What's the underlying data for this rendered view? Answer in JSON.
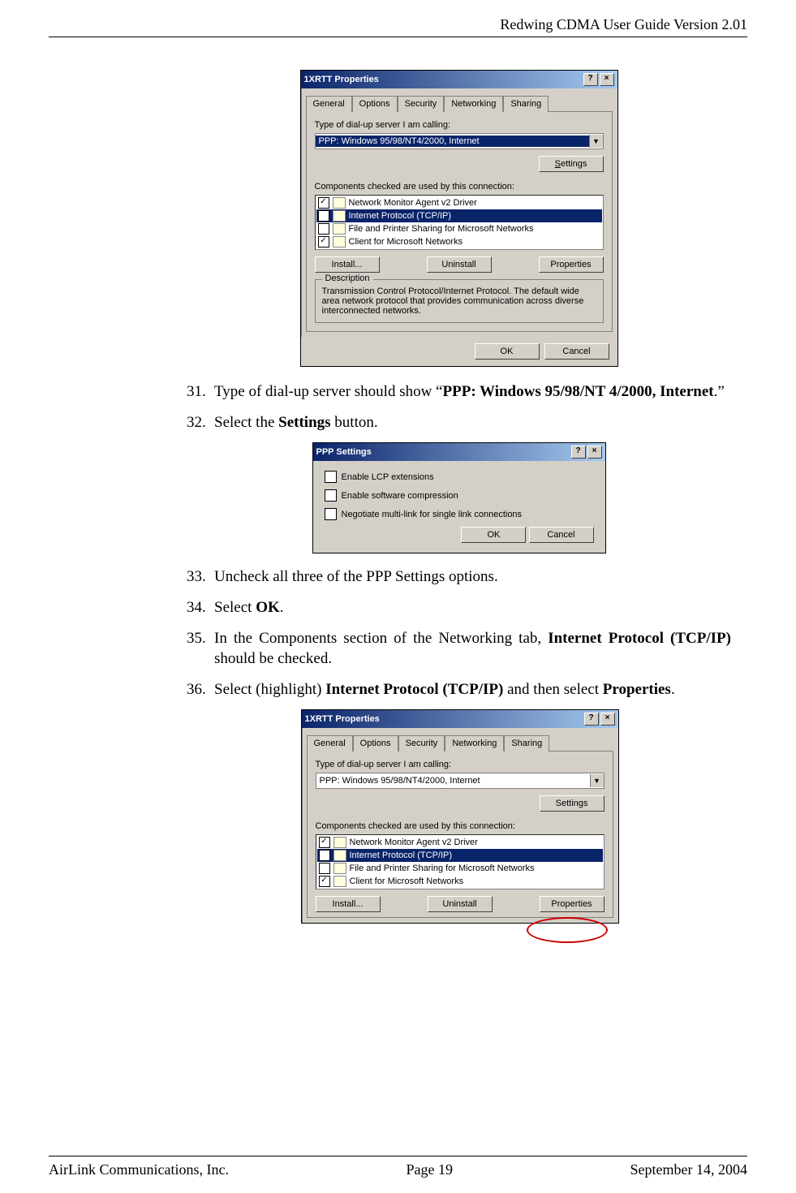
{
  "header": {
    "doc_title": "Redwing CDMA User Guide Version 2.01"
  },
  "footer": {
    "company": "AirLink Communications, Inc.",
    "page": "Page 19",
    "date": "September 14, 2004"
  },
  "dialog1": {
    "title": "1XRTT Properties",
    "tabs": [
      "General",
      "Options",
      "Security",
      "Networking",
      "Sharing"
    ],
    "active_tab": "Networking",
    "type_label": "Type of dial-up server I am calling:",
    "dropdown_value": "PPP: Windows 95/98/NT4/2000, Internet",
    "settings_btn": "Settings",
    "components_label": "Components checked are used by this connection:",
    "components": [
      {
        "checked": true,
        "label": "Network Monitor Agent v2 Driver",
        "selected": false
      },
      {
        "checked": true,
        "label": "Internet Protocol (TCP/IP)",
        "selected": true
      },
      {
        "checked": false,
        "label": "File and Printer Sharing for Microsoft Networks",
        "selected": false
      },
      {
        "checked": true,
        "label": "Client for Microsoft Networks",
        "selected": false
      }
    ],
    "install_btn": "Install...",
    "uninstall_btn": "Uninstall",
    "properties_btn": "Properties",
    "desc_legend": "Description",
    "desc_text": "Transmission Control Protocol/Internet Protocol. The default wide area network protocol that provides communication across diverse interconnected networks.",
    "ok": "OK",
    "cancel": "Cancel"
  },
  "ppp_dialog": {
    "title": "PPP Settings",
    "opt1": "Enable LCP extensions",
    "opt2": "Enable software compression",
    "opt3": "Negotiate multi-link for single link connections",
    "ok": "OK",
    "cancel": "Cancel"
  },
  "dialog3": {
    "title": "1XRTT Properties",
    "tabs": [
      "General",
      "Options",
      "Security",
      "Networking",
      "Sharing"
    ],
    "type_label": "Type of dial-up server I am calling:",
    "dropdown_value": "PPP: Windows 95/98/NT4/2000, Internet",
    "settings_btn": "Settings",
    "components_label": "Components checked are used by this connection:",
    "components": [
      {
        "checked": true,
        "label": "Network Monitor Agent v2 Driver",
        "selected": false
      },
      {
        "checked": true,
        "label": "Internet Protocol (TCP/IP)",
        "selected": true
      },
      {
        "checked": false,
        "label": "File and Printer Sharing for Microsoft Networks",
        "selected": false
      },
      {
        "checked": true,
        "label": "Client for Microsoft Networks",
        "selected": false
      }
    ],
    "install_btn": "Install...",
    "uninstall_btn": "Uninstall",
    "properties_btn": "Properties"
  },
  "steps": {
    "s31_num": "31.",
    "s31_a": "Type of dial-up server should show “",
    "s31_b": "PPP: Windows 95/98/NT 4/2000, Internet",
    "s31_c": ".”",
    "s32_num": "32.",
    "s32_a": "Select the ",
    "s32_b": "Settings",
    "s32_c": " button.",
    "s33_num": "33.",
    "s33": "Uncheck all three of the PPP Settings options.",
    "s34_num": "34.",
    "s34_a": "Select ",
    "s34_b": "OK",
    "s34_c": ".",
    "s35_num": "35.",
    "s35_a": "In the Components section of the Networking tab, ",
    "s35_b": "Internet Protocol (TCP/IP)",
    "s35_c": " should be checked.",
    "s36_num": "36.",
    "s36_a": "Select (highlight) ",
    "s36_b": "Internet Protocol (TCP/IP)",
    "s36_c": " and then select ",
    "s36_d": "Properties",
    "s36_e": "."
  }
}
